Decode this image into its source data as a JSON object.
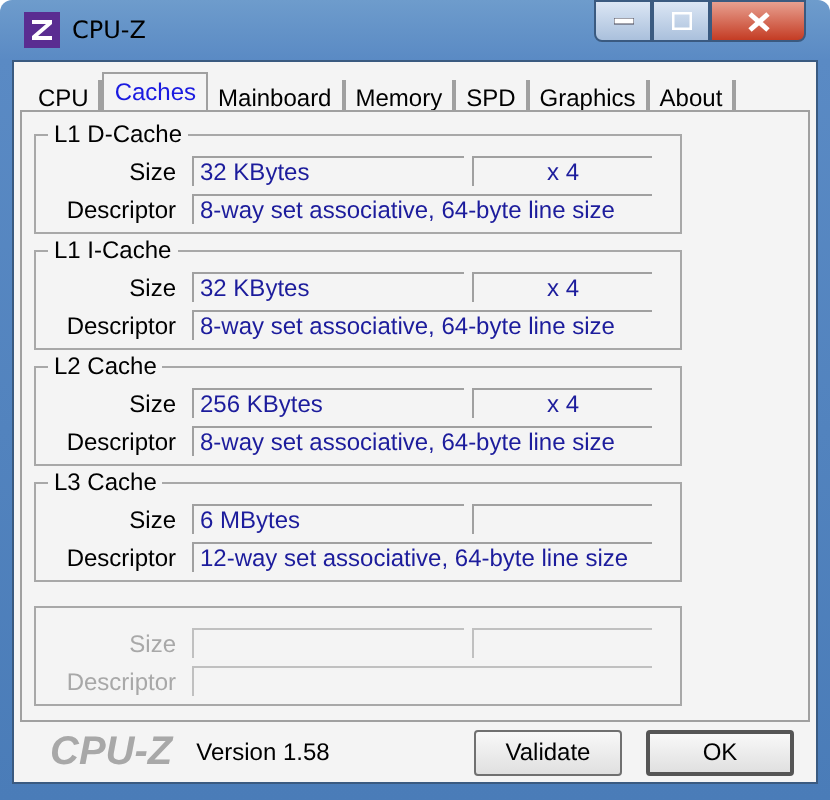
{
  "window": {
    "title": "CPU-Z"
  },
  "tabs": [
    {
      "label": "CPU",
      "selected": false
    },
    {
      "label": "Caches",
      "selected": true
    },
    {
      "label": "Mainboard",
      "selected": false
    },
    {
      "label": "Memory",
      "selected": false
    },
    {
      "label": "SPD",
      "selected": false
    },
    {
      "label": "Graphics",
      "selected": false
    },
    {
      "label": "About",
      "selected": false
    }
  ],
  "caches": [
    {
      "title": "L1 D-Cache",
      "disabled": false,
      "size_label": "Size",
      "size": "32 KBytes",
      "count": "x 4",
      "descriptor_label": "Descriptor",
      "descriptor": "8-way set associative, 64-byte line size"
    },
    {
      "title": "L1 I-Cache",
      "disabled": false,
      "size_label": "Size",
      "size": "32 KBytes",
      "count": "x 4",
      "descriptor_label": "Descriptor",
      "descriptor": "8-way set associative, 64-byte line size"
    },
    {
      "title": "L2 Cache",
      "disabled": false,
      "size_label": "Size",
      "size": "256 KBytes",
      "count": "x 4",
      "descriptor_label": "Descriptor",
      "descriptor": "8-way set associative, 64-byte line size"
    },
    {
      "title": "L3 Cache",
      "disabled": false,
      "size_label": "Size",
      "size": "6 MBytes",
      "descriptor_label": "Descriptor",
      "descriptor": "12-way set associative, 64-byte line size"
    },
    {
      "disabled": true,
      "size_label": "Size",
      "descriptor_label": "Descriptor"
    }
  ],
  "footer": {
    "logo": "CPU-Z",
    "version": "Version 1.58",
    "buttons": [
      "Validate",
      "OK"
    ]
  }
}
